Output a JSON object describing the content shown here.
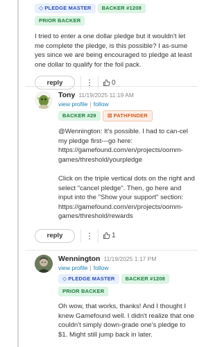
{
  "comment1": {
    "badges": [
      "PLEDGE MASTER",
      "BACKER #1208",
      "PRIOR BACKER"
    ],
    "text": "I tried to enter a one dollar pledge but it wouldn't let me complete the pledge, is this possible?  I as-sume yes since we are being encouraged to pledge at least one dollar to qualify for the foil pack.",
    "reply_label": "reply",
    "likes": "0"
  },
  "comment2": {
    "author": "Tony",
    "timestamp": "11/19/2025 11:19 AM",
    "view_profile": "view profile",
    "follow": "follow",
    "badges": [
      "BACKER #29",
      "PATHFINDER"
    ],
    "para1": "@Wennington: It's possible. I had to can-cel my pledge first---go here: https://gamefound.com/en/projects/oomm-games/threshold/yourpledge",
    "para2": "Click on the triple vertical dots on the right and select \"cancel pledge\". Then, go here and input into the \"Show your support\" section: https://gamefound.com/en/projects/oomm-games/threshold/rewards",
    "reply_label": "reply",
    "likes": "1"
  },
  "comment3": {
    "author": "Wennington",
    "timestamp": "11/19/2025 1:17 PM",
    "view_profile": "view profile",
    "follow": "follow",
    "badges": [
      "PLEDGE MASTER",
      "BACKER #1208",
      "PRIOR BACKER"
    ],
    "text": "Oh wow, that works, thanks!  And I thought I knew Gamefound well.  I didn't realize that one couldn't simply down-grade one's pledge to $1.  Might still jump back in later."
  },
  "separator": "|",
  "icons": {
    "diamond": "diamond-icon",
    "pathfinder": "pathfinder-icon",
    "dots": "more-vertical-icon",
    "thumb": "thumbs-up-icon"
  },
  "colors": {
    "link": "#1a7fb2",
    "badge_blue_bg": "#e8f0fe",
    "badge_green_bg": "#dbf4e3",
    "badge_orange": "#d05a1e"
  }
}
